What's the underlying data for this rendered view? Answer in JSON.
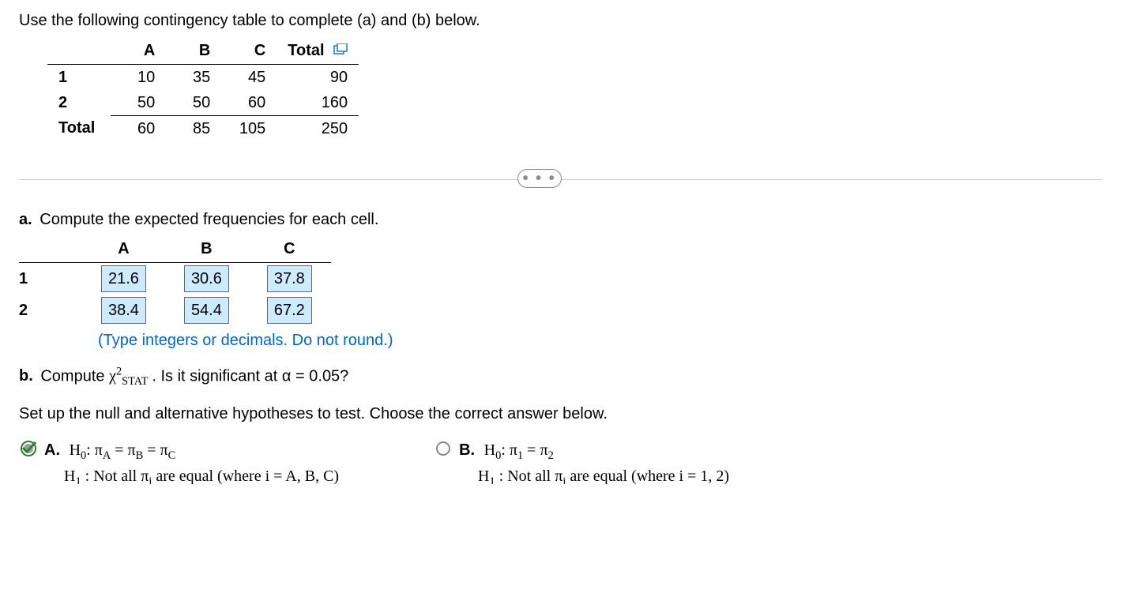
{
  "prompt": "Use the following contingency table to complete (a) and (b) below.",
  "contingency": {
    "col_headers": [
      "A",
      "B",
      "C",
      "Total"
    ],
    "rows": [
      {
        "label": "1",
        "cells": [
          "10",
          "35",
          "45",
          "90"
        ]
      },
      {
        "label": "2",
        "cells": [
          "50",
          "50",
          "60",
          "160"
        ]
      }
    ],
    "total_row": {
      "label": "Total",
      "cells": [
        "60",
        "85",
        "105",
        "250"
      ]
    }
  },
  "ellipsis": "• • •",
  "part_a": {
    "label": "a.",
    "text": "Compute the expected frequencies for each cell.",
    "col_headers": [
      "A",
      "B",
      "C"
    ],
    "rows": [
      {
        "label": "1",
        "cells": [
          "21.6",
          "30.6",
          "37.8"
        ]
      },
      {
        "label": "2",
        "cells": [
          "38.4",
          "54.4",
          "67.2"
        ]
      }
    ],
    "hint": "(Type integers or decimals. Do not round.)"
  },
  "part_b": {
    "label": "b.",
    "prefix": "Compute ",
    "stat_symbol_html": "χ",
    "stat_sub": "STAT",
    "stat_sup": "2",
    "suffix": " .  Is it significant at α = 0.05?",
    "subprompt": "Set up the null and alternative hypotheses to test. Choose the correct answer below.",
    "choices": [
      {
        "letter": "A.",
        "selected": true,
        "h0": "H₀: π_A = π_B = π_C",
        "h1_cut": "H₁ : Not all π_i  are equal (where i = A, B, C)"
      },
      {
        "letter": "B.",
        "selected": false,
        "h0": "H₀: π₁ = π₂",
        "h1_cut": "H₁ : Not all π_i  are equal (where i = 1, 2)"
      }
    ]
  }
}
